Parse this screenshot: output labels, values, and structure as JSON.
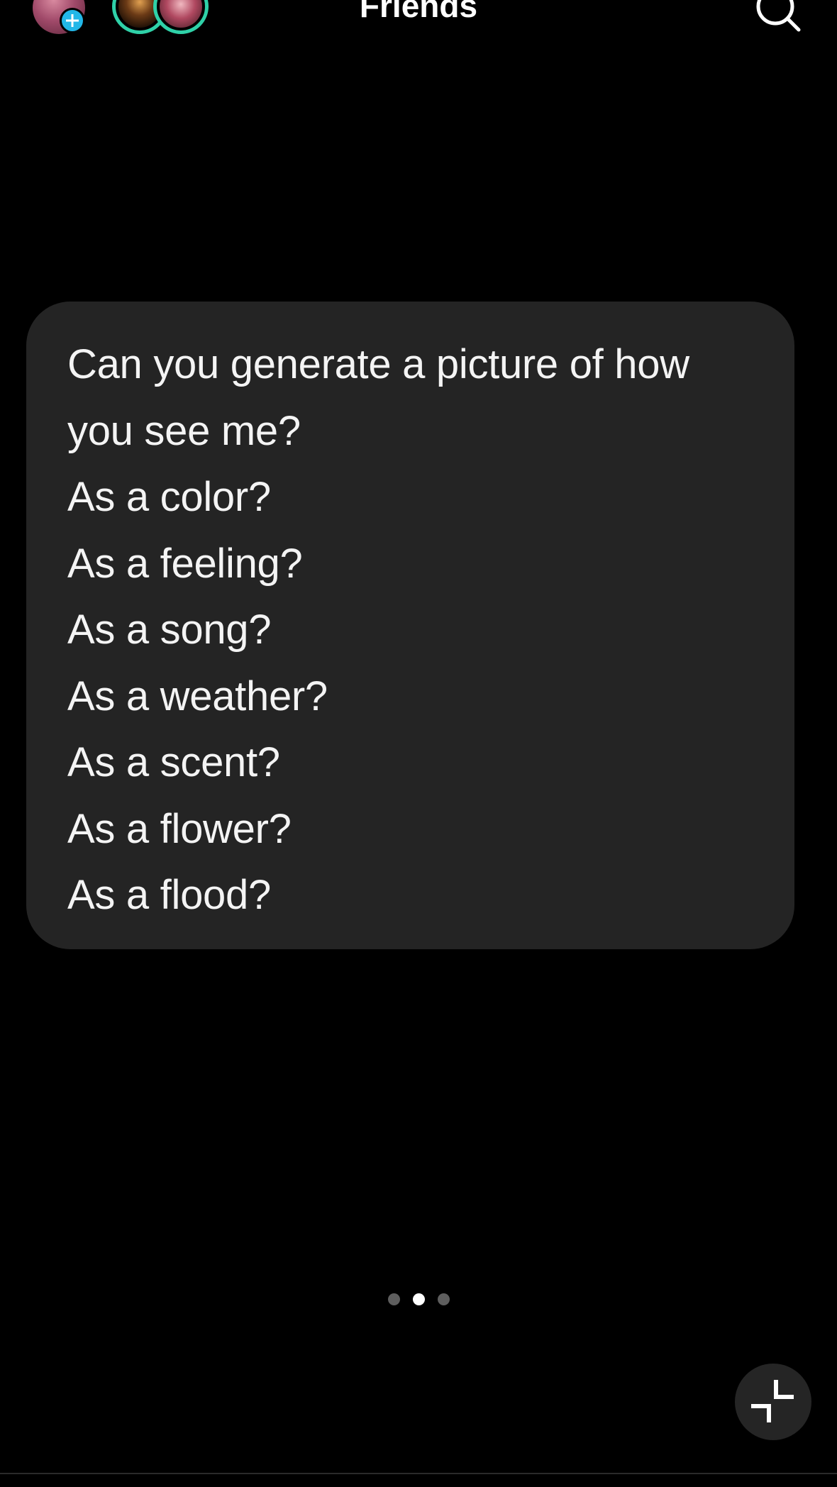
{
  "header": {
    "title": "Friends",
    "icons": {
      "add_story": "plus-icon",
      "search": "search-icon"
    }
  },
  "message": {
    "lines": [
      "Can you generate a picture of how",
      "you see me?",
      "As a color?",
      "As a feeling?",
      "As a song?",
      "As a weather?",
      "As a scent?",
      "As a flower?",
      "As a flood?"
    ]
  },
  "pager": {
    "total": 3,
    "active_index": 1
  },
  "controls": {
    "minimize_icon": "minimize-icon"
  },
  "colors": {
    "background": "#000000",
    "card": "#242424",
    "story_ring": "#2fd1a8",
    "add_badge": "#22b7e8"
  }
}
